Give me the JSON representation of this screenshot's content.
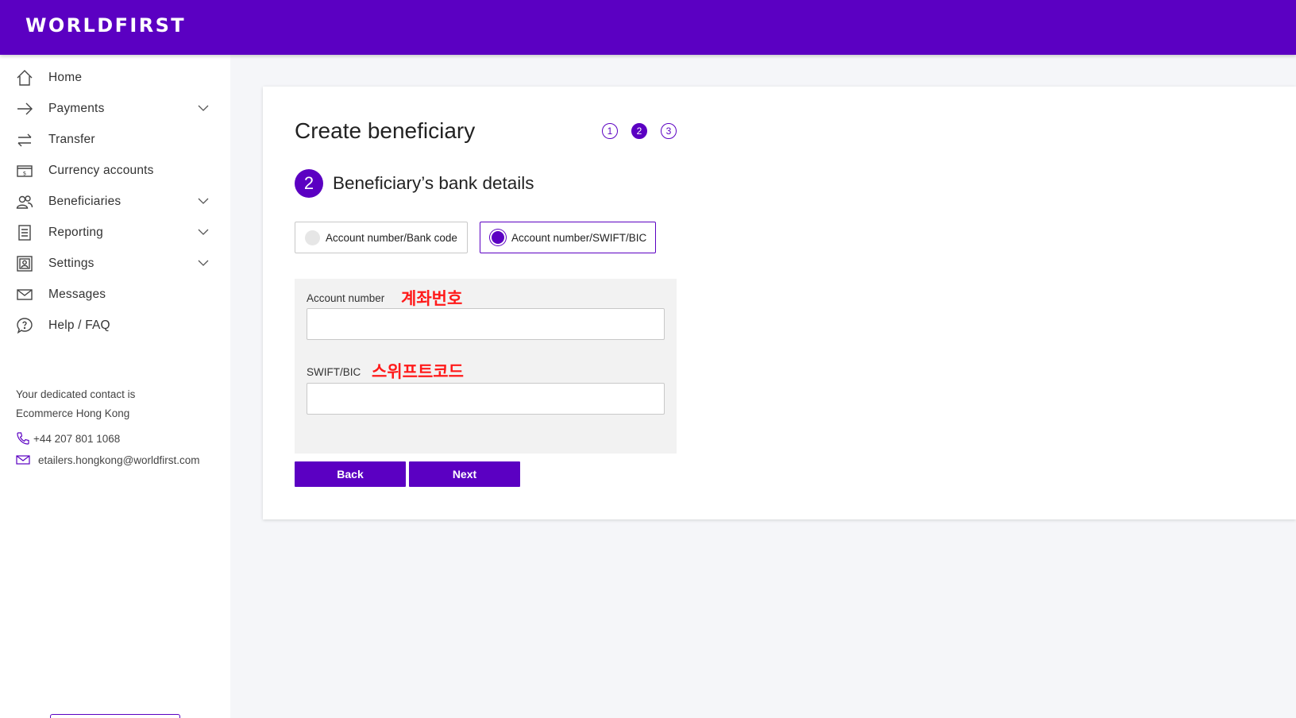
{
  "brand": {
    "logo": "WORLDFIRST",
    "primary_color": "#5b00c2",
    "annotation_color": "#ff1a1a"
  },
  "sidebar": {
    "items": [
      {
        "label": "Home",
        "icon": "home-icon",
        "has_chevron": false
      },
      {
        "label": "Payments",
        "icon": "arrow-right-icon",
        "has_chevron": true
      },
      {
        "label": "Transfer",
        "icon": "transfer-arrows-icon",
        "has_chevron": false
      },
      {
        "label": "Currency accounts",
        "icon": "currency-account-icon",
        "has_chevron": false
      },
      {
        "label": "Beneficiaries",
        "icon": "people-icon",
        "has_chevron": true
      },
      {
        "label": "Reporting",
        "icon": "report-document-icon",
        "has_chevron": true
      },
      {
        "label": "Settings",
        "icon": "settings-profile-icon",
        "has_chevron": true
      },
      {
        "label": "Messages",
        "icon": "envelope-icon",
        "has_chevron": false
      },
      {
        "label": "Help / FAQ",
        "icon": "help-bubble-icon",
        "has_chevron": false
      }
    ],
    "contact": {
      "line1": "Your dedicated contact is",
      "line2": "Ecommerce Hong Kong",
      "phone": "+44 207 801 1068",
      "email": "etailers.hongkong@worldfirst.com"
    }
  },
  "main": {
    "title": "Create beneficiary",
    "steps": [
      "1",
      "2",
      "3"
    ],
    "active_step": "2",
    "section_number": "2",
    "section_title": "Beneficiary’s bank details",
    "options": [
      {
        "label": "Account number/Bank code",
        "selected": false
      },
      {
        "label": "Account number/SWIFT/BIC",
        "selected": true
      }
    ],
    "fields": {
      "account_number_label": "Account number",
      "account_number_note": "계좌번호",
      "account_number_value": "",
      "swift_label": "SWIFT/BIC",
      "swift_note": "스위프트코드",
      "swift_value": ""
    },
    "buttons": {
      "back": "Back",
      "next": "Next"
    }
  }
}
